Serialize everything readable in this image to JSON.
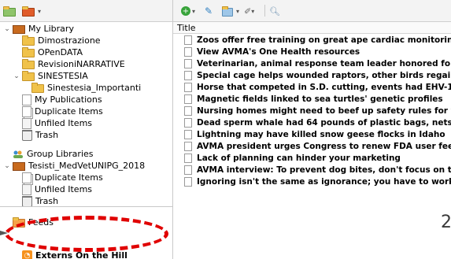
{
  "left": {
    "tree": [
      {
        "id": "my-library",
        "label": "My Library",
        "indent": 0,
        "twisty": "v",
        "icon": "library-icon"
      },
      {
        "id": "dimostrazione",
        "label": "Dimostrazione",
        "indent": 1,
        "twisty": "",
        "icon": "folder-icon"
      },
      {
        "id": "opendata",
        "label": "OPenDATA",
        "indent": 1,
        "twisty": "",
        "icon": "folder-icon"
      },
      {
        "id": "revisioni",
        "label": "RevisioniNARRATIVE",
        "indent": 1,
        "twisty": "",
        "icon": "folder-icon"
      },
      {
        "id": "sinestesia",
        "label": "SINESTESIA",
        "indent": 1,
        "twisty": "v",
        "icon": "folder-icon"
      },
      {
        "id": "sinestesia-importanti",
        "label": "Sinestesia_Importanti",
        "indent": 2,
        "twisty": "",
        "icon": "folder-icon"
      },
      {
        "id": "my-publications",
        "label": "My Publications",
        "indent": 1,
        "twisty": "",
        "icon": "doc-icon"
      },
      {
        "id": "duplicate-items",
        "label": "Duplicate Items",
        "indent": 1,
        "twisty": "",
        "icon": "duplicate-icon"
      },
      {
        "id": "unfiled-items",
        "label": "Unfiled Items",
        "indent": 1,
        "twisty": "",
        "icon": "unfiled-icon"
      },
      {
        "id": "trash",
        "label": "Trash",
        "indent": 1,
        "twisty": "",
        "icon": "trash-icon"
      },
      {
        "id": "group-libraries",
        "label": "Group Libraries",
        "indent": 0,
        "twisty": "",
        "icon": "group-icon"
      },
      {
        "id": "tesisti",
        "label": "Tesisti_MedVetUNIPG_2018",
        "indent": 0,
        "twisty": "v",
        "icon": "library-icon"
      },
      {
        "id": "g-duplicate",
        "label": "Duplicate Items",
        "indent": 1,
        "twisty": "",
        "icon": "duplicate-icon"
      },
      {
        "id": "g-unfiled",
        "label": "Unfiled Items",
        "indent": 1,
        "twisty": "",
        "icon": "unfiled-icon"
      },
      {
        "id": "g-trash",
        "label": "Trash",
        "indent": 1,
        "twisty": "",
        "icon": "trash-icon"
      },
      {
        "id": "feeds",
        "label": "Feeds",
        "indent": 0,
        "twisty": "",
        "icon": "feeds-icon"
      },
      {
        "id": "externs",
        "label": "Externs On the Hill",
        "indent": 1,
        "twisty": "",
        "icon": "rss-icon"
      }
    ]
  },
  "right": {
    "column_header": "Title",
    "items": [
      "Zoos offer free training on great ape cardiac monitoring",
      "View AVMA's One Health resources",
      "Veterinarian, animal response team leader honored for roles in hoarding",
      "Special cage helps wounded raptors, other birds regain ability to fly",
      "Horse that competed in S.D. cutting, events had EHV-1",
      "Magnetic fields linked to sea turtles' genetic profiles",
      "Nursing homes might need to beef up safety rules for visiting pets",
      "Dead sperm whale had 64 pounds of plastic bags, nets, other trash in g",
      "Lightning may have killed snow geese flocks in Idaho",
      "AVMA president urges Congress to renew FDA user fee programs",
      "Lack of planning can hinder your marketing",
      "AVMA interview: To prevent dog bites, don't focus on the breed",
      "Ignoring isn't the same as ignorance; you have to work at it."
    ]
  },
  "annotations": {
    "slide_number": "2"
  },
  "colors": {
    "highlight_oval": "#e00000",
    "folder": "#f0c24a",
    "rss": "#f6921e"
  }
}
